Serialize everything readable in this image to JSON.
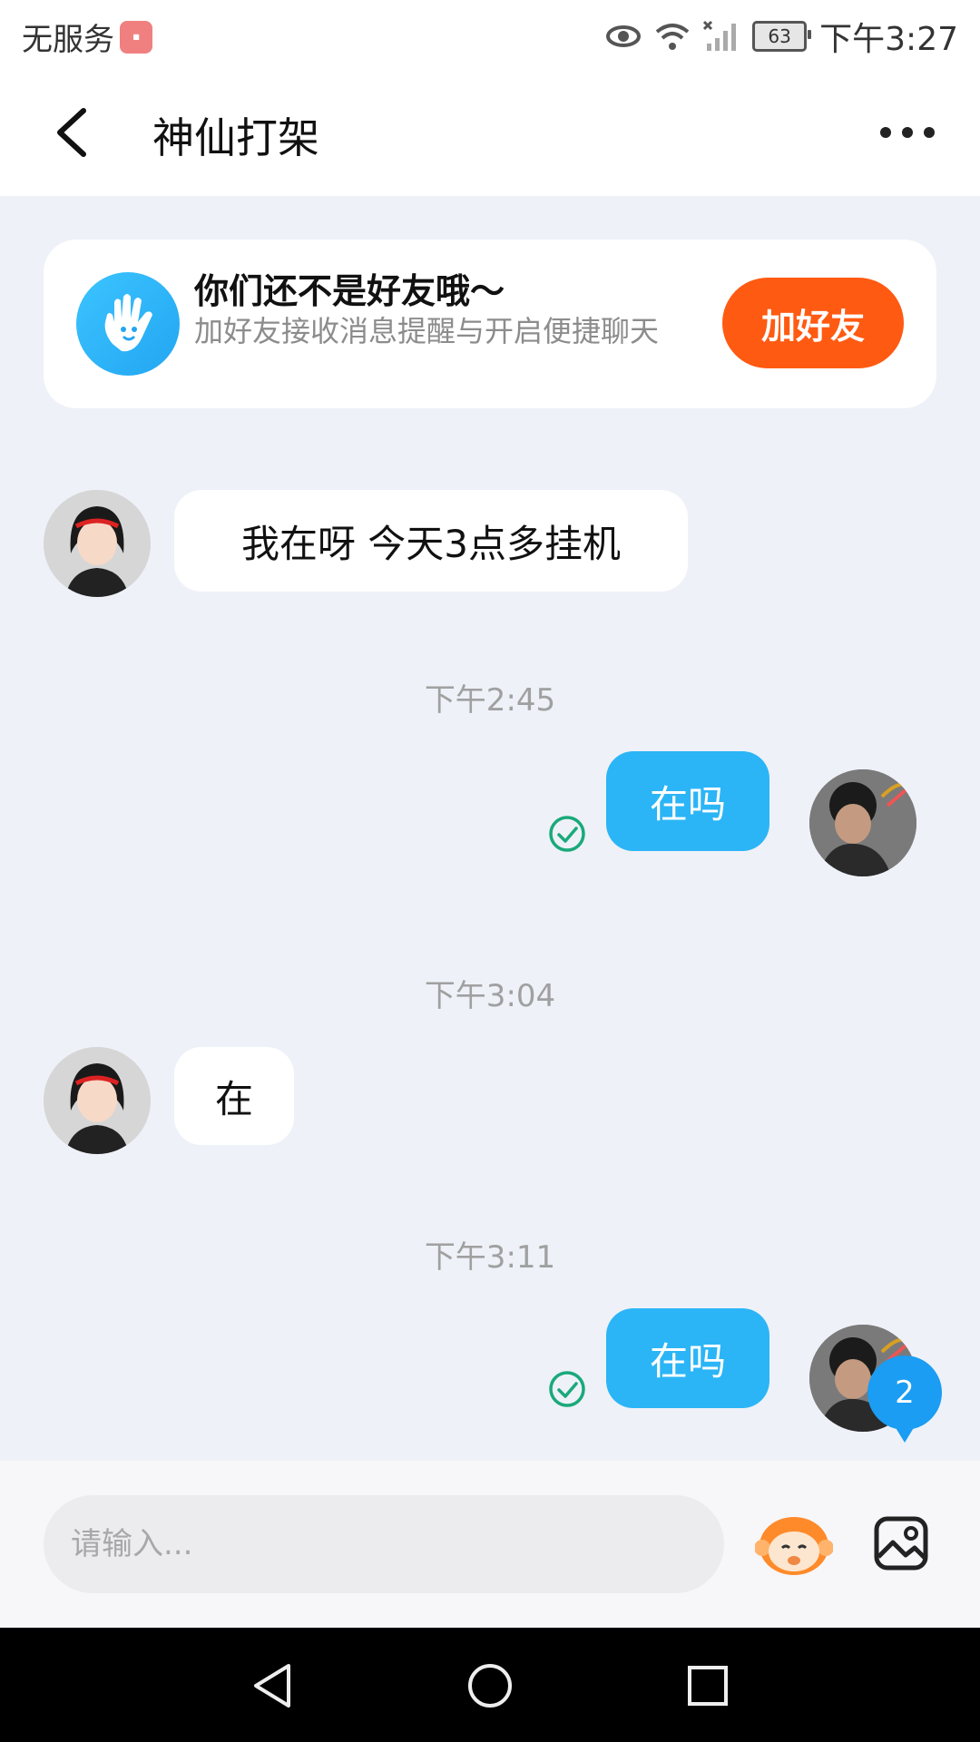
{
  "status_bar": {
    "carrier": "无服务",
    "battery": "63",
    "time": "下午3:27"
  },
  "header": {
    "title": "神仙打架"
  },
  "friend_card": {
    "title": "你们还不是好友哦～",
    "subtitle": "加好友接收消息提醒与开启便捷聊天",
    "button": "加好友"
  },
  "messages": [
    {
      "direction": "in",
      "text": "我在呀 今天3点多挂机"
    },
    {
      "type": "time",
      "text": "下午2:45"
    },
    {
      "direction": "out",
      "text": "在吗",
      "status": "read"
    },
    {
      "type": "time",
      "text": "下午3:04"
    },
    {
      "direction": "in",
      "text": "在"
    },
    {
      "type": "time",
      "text": "下午3:11"
    },
    {
      "direction": "out",
      "text": "在吗",
      "status": "read"
    }
  ],
  "unread_badge": "2",
  "input": {
    "placeholder": "请输入..."
  },
  "colors": {
    "accent_blue": "#2bb5f6",
    "add_friend_orange": "#ff5a12",
    "read_green": "#1aa97a"
  },
  "icons": [
    "back-arrow-icon",
    "more-dots-icon",
    "wave-hand-icon",
    "check-circle-icon",
    "emoji-monkey-icon",
    "image-icon",
    "nav-back-icon",
    "nav-home-icon",
    "nav-recents-icon",
    "eye-icon",
    "wifi-icon",
    "signal-icon"
  ]
}
